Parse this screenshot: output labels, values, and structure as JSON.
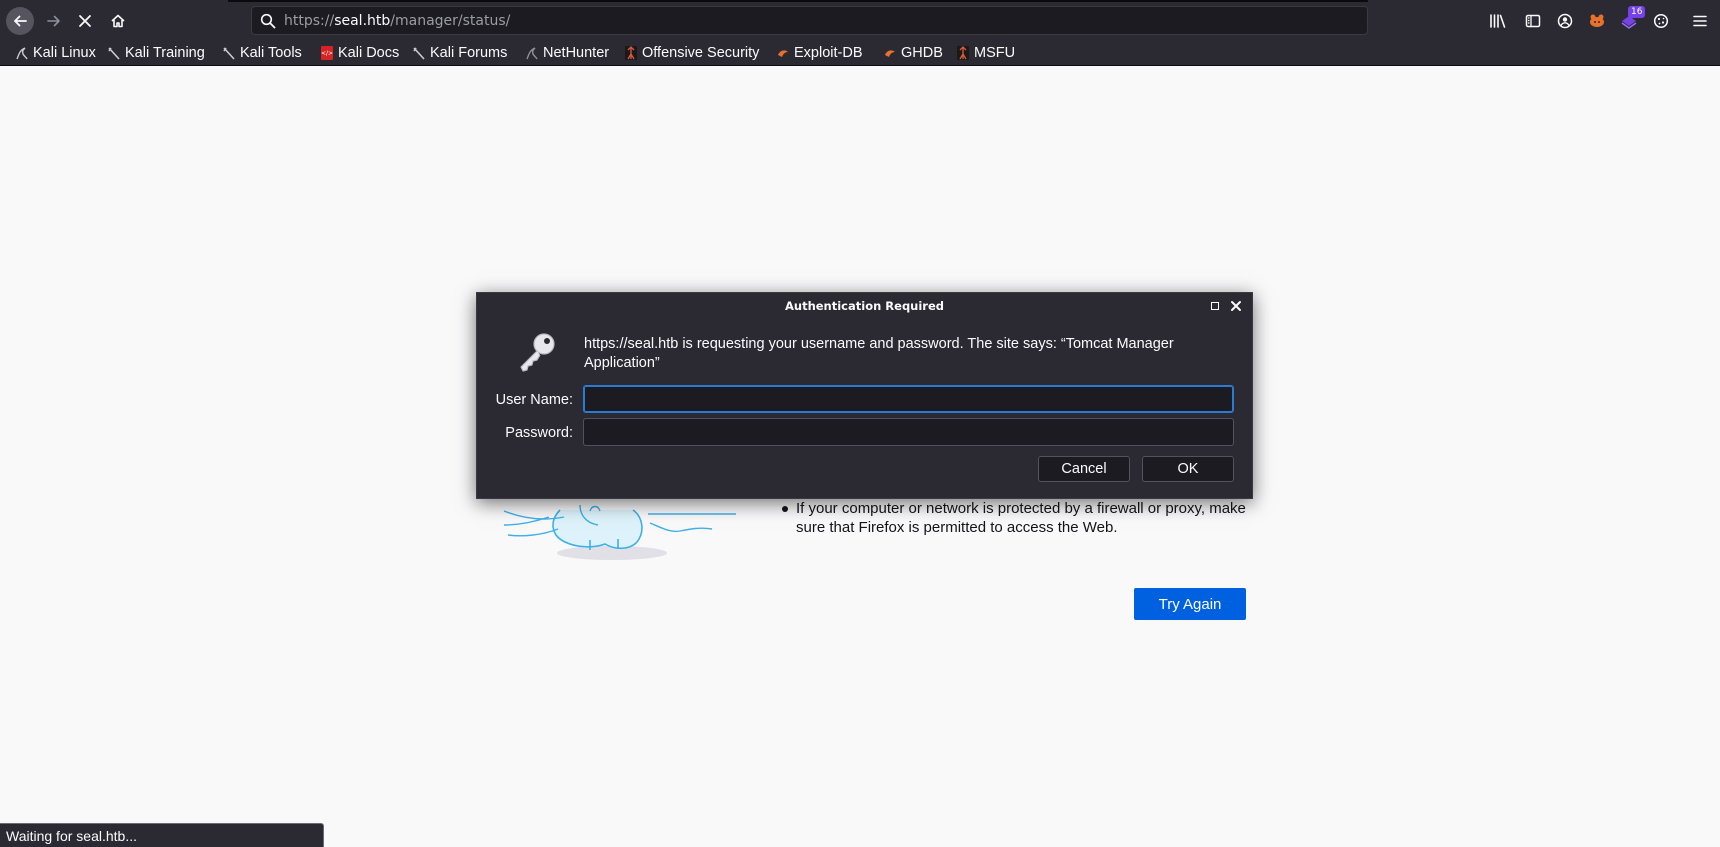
{
  "browser": {
    "url": {
      "prefix": "https://",
      "host": "seal.htb",
      "path": "/manager/status/"
    },
    "toolbar_icons": [
      "back-icon",
      "forward-icon",
      "stop-icon",
      "home-icon",
      "search-icon",
      "library-icon",
      "sidebar-icon",
      "account-icon",
      "extension-icon",
      "extension-icon",
      "cookie-icon",
      "menu-icon"
    ],
    "extension_badge": "16",
    "accent_color": "#0061e0"
  },
  "bookmarks": [
    {
      "label": "Kali Linux",
      "icon": "kali-dragon-icon"
    },
    {
      "label": "Kali Training",
      "icon": "kali-training-icon"
    },
    {
      "label": "Kali Tools",
      "icon": "kali-tools-icon"
    },
    {
      "label": "Kali Docs",
      "icon": "kali-docs-icon"
    },
    {
      "label": "Kali Forums",
      "icon": "kali-forums-icon"
    },
    {
      "label": "NetHunter",
      "icon": "nethunter-icon"
    },
    {
      "label": "Offensive Security",
      "icon": "offsec-icon"
    },
    {
      "label": "Exploit-DB",
      "icon": "exploit-db-icon"
    },
    {
      "label": "GHDB",
      "icon": "ghdb-icon"
    },
    {
      "label": "MSFU",
      "icon": "msfu-icon"
    }
  ],
  "page": {
    "tip": "If your computer or network is protected by a firewall or proxy, make sure that Firefox is permitted to access the Web.",
    "try_again": "Try Again"
  },
  "dialog": {
    "title": "Authentication Required",
    "message": "https://seal.htb is requesting your username and password. The site says: “Tomcat Manager Application”",
    "username_label": "User Name:",
    "password_label": "Password:",
    "username_value": "",
    "password_value": "",
    "cancel": "Cancel",
    "ok": "OK"
  },
  "status": "Waiting for seal.htb..."
}
